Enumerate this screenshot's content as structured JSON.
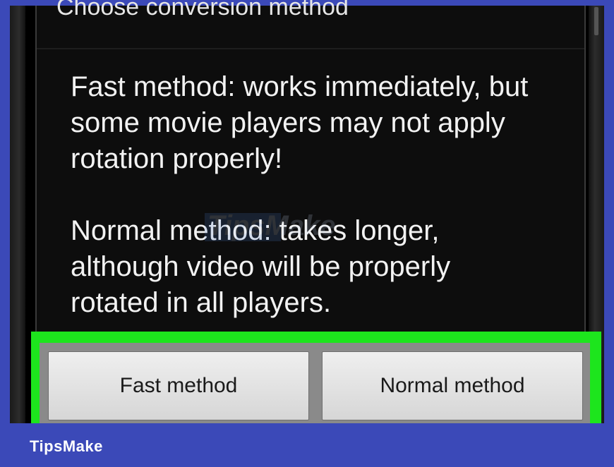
{
  "dialog": {
    "title": "Choose conversion method",
    "message_fast": "Fast method: works immediately, but\nsome movie players may not apply\nrotation properly!",
    "message_normal": "Normal method: takes longer,\nalthough video will be properly\nrotated in all players."
  },
  "buttons": {
    "fast_label": "Fast method",
    "normal_label": "Normal method"
  },
  "watermark": {
    "center_text": "TipsMake",
    "brand_label": "TipsMake"
  },
  "colors": {
    "highlight": "#1de51d",
    "brand_bar": "#3b49b8",
    "dialog_bg": "#0d0d0d"
  }
}
